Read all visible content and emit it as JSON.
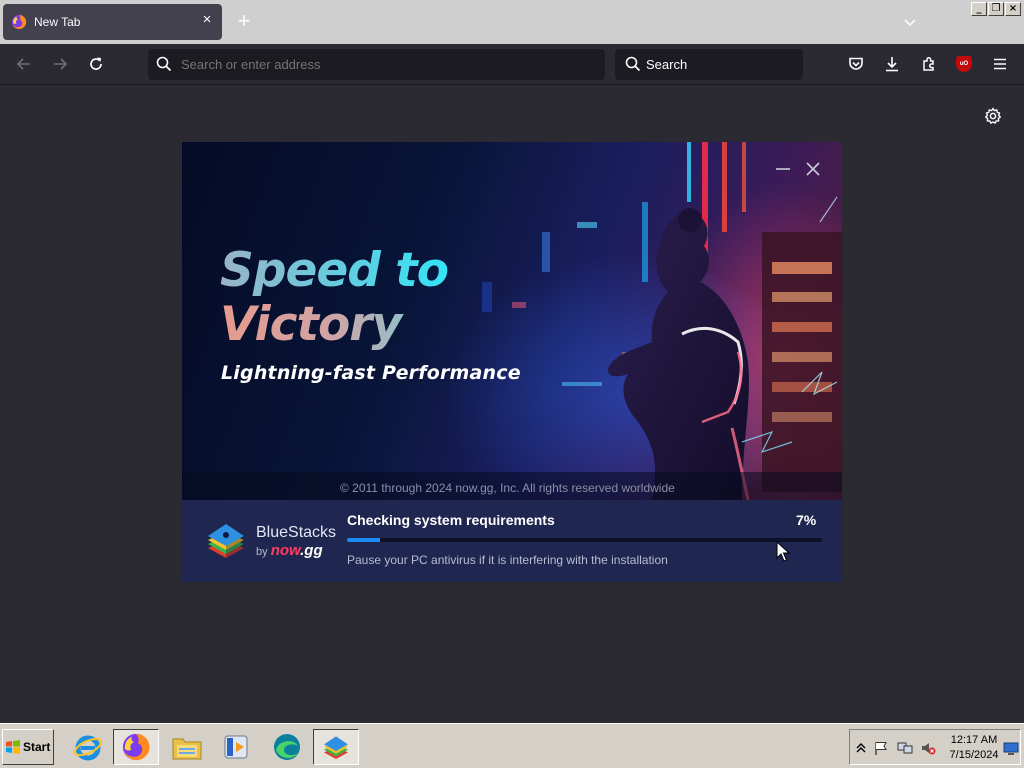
{
  "browser": {
    "tab": {
      "title": "New Tab",
      "favicon": "firefox-icon",
      "close_label": "×"
    },
    "new_tab_label": "+",
    "urlbar": {
      "placeholder": "Search or enter address"
    },
    "searchbar": {
      "label": "Search"
    },
    "ublock_label": "uO",
    "window_controls": {
      "minimize": "_",
      "restore": "❐",
      "close": "×"
    }
  },
  "installer": {
    "headline_line1": "Speed to",
    "headline_line2": "Victory",
    "subheadline": "Lightning-fast Performance",
    "copyright": "© 2011 through 2024 now.gg, Inc. All rights reserved worldwide",
    "brand": {
      "name": "BlueStacks",
      "by": "by",
      "partner_prefix": "now",
      "partner_suffix": ".gg"
    },
    "status": {
      "title": "Checking system requirements",
      "percent_label": "7%",
      "progress": 0.07,
      "hint": "Pause your PC antivirus if it is interfering with the installation"
    },
    "accent_color": "#1b8cf5"
  },
  "taskbar": {
    "start_label": "Start",
    "apps": [
      "internet-explorer-icon",
      "firefox-icon",
      "file-explorer-icon",
      "media-player-icon",
      "edge-icon",
      "bluestacks-icon"
    ],
    "clock": {
      "time": "12:17 AM",
      "date": "7/15/2024"
    }
  }
}
